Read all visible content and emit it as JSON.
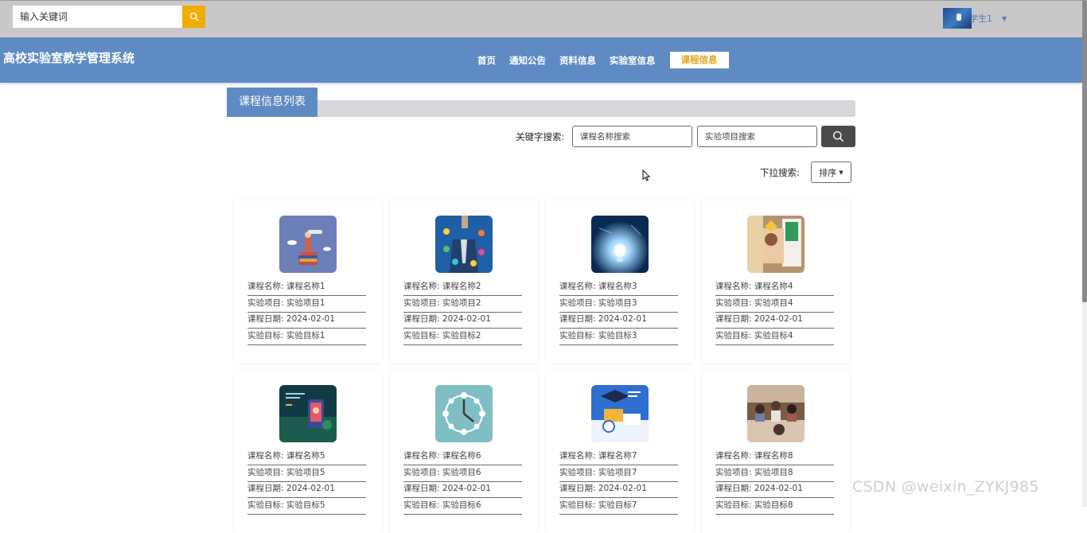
{
  "topbar": {
    "search_placeholder": "输入关键词",
    "user_name": "学生1"
  },
  "navbar": {
    "site_title": "高校实验室教学管理系统",
    "items": [
      "首页",
      "通知公告",
      "资料信息",
      "实验室信息",
      "课程信息"
    ],
    "active_index": 4
  },
  "list": {
    "title": "课程信息列表",
    "keyword_label": "关键字搜索:",
    "name_placeholder": "课程名称搜索",
    "item_placeholder": "实验项目搜索",
    "dropdown_label": "下拉搜索:",
    "sort_label": "排序"
  },
  "field_labels": {
    "name": "课程名称",
    "item": "实验项目",
    "date": "课程日期",
    "goal": "实验目标"
  },
  "courses": [
    {
      "name": "课程名称1",
      "item": "实验项目1",
      "date": "2024-02-01",
      "goal": "实验目标1",
      "image": "telescope-books-illustration"
    },
    {
      "name": "课程名称2",
      "item": "实验项目2",
      "date": "2024-02-01",
      "goal": "实验目标2",
      "image": "businessman-icons-photo"
    },
    {
      "name": "课程名称3",
      "item": "实验项目3",
      "date": "2024-02-01",
      "goal": "实验目标3",
      "image": "glowing-lightbulb-photo"
    },
    {
      "name": "课程名称4",
      "item": "实验项目4",
      "date": "2024-02-01",
      "goal": "实验目标4",
      "image": "tablet-learning-photo"
    },
    {
      "name": "课程名称5",
      "item": "实验项目5",
      "date": "2024-02-01",
      "goal": "实验目标5",
      "image": "online-education-illustration"
    },
    {
      "name": "课程名称6",
      "item": "实验项目6",
      "date": "2024-02-01",
      "goal": "实验目标6",
      "image": "education-clock-icons"
    },
    {
      "name": "课程名称7",
      "item": "实验项目7",
      "date": "2024-02-01",
      "goal": "实验目标7",
      "image": "graduation-study-illustration"
    },
    {
      "name": "课程名称8",
      "item": "实验项目8",
      "date": "2024-02-01",
      "goal": "实验目标8",
      "image": "classroom-students-photo"
    }
  ],
  "watermark": "CSDN @weixin_ZYKJ985",
  "colors": {
    "topbar": "#c8c8c8",
    "nav": "#5e8bc3",
    "search_button": "#f0ad00",
    "active_nav_text": "#e3a21a",
    "keyword_button": "#4a4a4a"
  }
}
